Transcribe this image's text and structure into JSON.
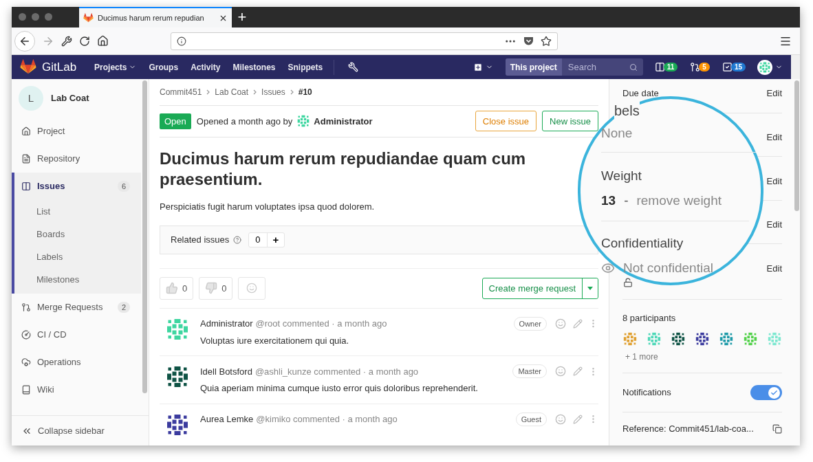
{
  "browser": {
    "tab_title": "Ducimus harum rerum repudian",
    "new_tab": "+"
  },
  "header": {
    "brand": "GitLab",
    "menu": [
      {
        "label": "Projects",
        "dropdown": true
      },
      {
        "label": "Groups",
        "dropdown": false
      },
      {
        "label": "Activity",
        "dropdown": false
      },
      {
        "label": "Milestones",
        "dropdown": false
      },
      {
        "label": "Snippets",
        "dropdown": false
      }
    ],
    "scope": "This project",
    "search_placeholder": "Search",
    "counters": [
      {
        "kind": "issues",
        "count": "11",
        "color": "#1aaa55"
      },
      {
        "kind": "merge",
        "count": "5",
        "color": "#fc9403"
      },
      {
        "kind": "todos",
        "count": "15",
        "color": "#1f78d1"
      }
    ]
  },
  "sidebar": {
    "initial": "L",
    "project": "Lab Coat",
    "items": [
      {
        "kind": "project",
        "label": "Project",
        "selected": false
      },
      {
        "kind": "repository",
        "label": "Repository",
        "selected": false
      },
      {
        "kind": "issues",
        "label": "Issues",
        "count": "6",
        "selected": true,
        "children": [
          {
            "label": "List"
          },
          {
            "label": "Boards"
          },
          {
            "label": "Labels"
          },
          {
            "label": "Milestones"
          }
        ]
      },
      {
        "kind": "merge",
        "label": "Merge Requests",
        "count": "2",
        "selected": false
      },
      {
        "kind": "cicd",
        "label": "CI / CD",
        "selected": false
      },
      {
        "kind": "operations",
        "label": "Operations",
        "selected": false
      },
      {
        "kind": "wiki",
        "label": "Wiki",
        "selected": false
      }
    ],
    "collapse": "Collapse sidebar"
  },
  "breadcrumbs": [
    "Commit451",
    "Lab Coat",
    "Issues",
    "#10"
  ],
  "issue": {
    "status": "Open",
    "opened": "Opened a month ago by",
    "author": "Administrator",
    "close_button": "Close issue",
    "new_button": "New issue",
    "title": "Ducimus harum rerum repudiandae quam cum praesentium.",
    "description": "Perspiciatis fugit harum voluptates ipsa quod dolorem.",
    "related_label": "Related issues",
    "related_count": "0",
    "related_add": "+",
    "awards": [
      {
        "kind": "thumbsup",
        "count": "0"
      },
      {
        "kind": "thumbsdown",
        "count": "0"
      }
    ],
    "merge_button": "Create merge request"
  },
  "comments": [
    {
      "author": "Administrator",
      "meta": "@root commented · a month ago",
      "role": "Owner",
      "body": "Voluptas iure exercitationem qui quia.",
      "color": "#3ed6a0"
    },
    {
      "author": "Idell Botsford",
      "meta": "@ashli_kunze commented · a month ago",
      "role": "Master",
      "body": "Quia aperiam minima cumque iusto error quis doloribus reprehenderit.",
      "color": "#0f5345"
    },
    {
      "author": "Aurea Lemke",
      "meta": "@kimiko commented · a month ago",
      "role": "Guest",
      "color": "#3b3b9e"
    }
  ],
  "right_sidebar": {
    "due_date": "Due date",
    "edit_links": [
      "Edit",
      "Edit",
      "Edit",
      "Edit",
      "Edit"
    ],
    "participants_title": "8 participants",
    "participants": [
      {
        "color": "#e0a030"
      },
      {
        "color": "#4ed8b8"
      },
      {
        "color": "#0f5345"
      },
      {
        "color": "#3b3b9e"
      },
      {
        "color": "#1e9aa8"
      },
      {
        "color": "#52d14a"
      },
      {
        "color": "#7de8d0"
      }
    ],
    "more": "+ 1 more",
    "notifications": "Notifications",
    "notifications_on": true,
    "reference": "Reference: Commit451/lab-coa..."
  },
  "magnifier": {
    "labels_title": "bels",
    "labels_value": "None",
    "weight_title": "Weight",
    "weight_value": "13",
    "weight_separator": "-",
    "remove_weight": "remove weight",
    "confidentiality_title": "Confidentiality",
    "confidentiality_value": "Not confidential"
  }
}
